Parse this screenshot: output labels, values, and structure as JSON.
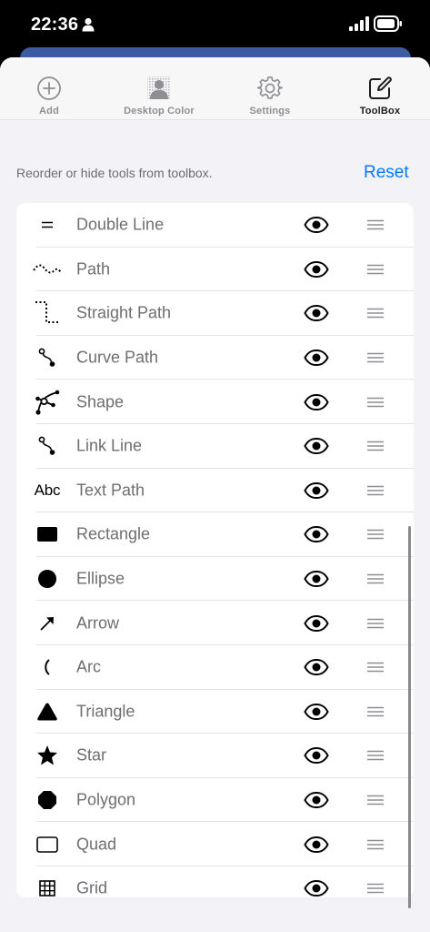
{
  "status_bar": {
    "time": "22:36"
  },
  "tabs": [
    {
      "label": "Add",
      "icon": "plus-circle-icon"
    },
    {
      "label": "Desktop Color",
      "icon": "desktop-color-icon"
    },
    {
      "label": "Settings",
      "icon": "gear-icon"
    },
    {
      "label": "ToolBox",
      "icon": "toolbox-edit-icon",
      "active": true
    }
  ],
  "hint": "Reorder or hide tools from toolbox.",
  "reset_label": "Reset",
  "icon_text_abc": "Abc",
  "tools": [
    {
      "label": "Double Line",
      "icon": "double-line-icon"
    },
    {
      "label": "Path",
      "icon": "path-icon"
    },
    {
      "label": "Straight Path",
      "icon": "straight-path-icon"
    },
    {
      "label": "Curve Path",
      "icon": "curve-path-icon"
    },
    {
      "label": "Shape",
      "icon": "shape-icon"
    },
    {
      "label": "Link Line",
      "icon": "link-line-icon"
    },
    {
      "label": "Text Path",
      "icon": "text-path-icon"
    },
    {
      "label": "Rectangle",
      "icon": "rectangle-icon"
    },
    {
      "label": "Ellipse",
      "icon": "ellipse-icon"
    },
    {
      "label": "Arrow",
      "icon": "arrow-icon"
    },
    {
      "label": "Arc",
      "icon": "arc-icon"
    },
    {
      "label": "Triangle",
      "icon": "triangle-icon"
    },
    {
      "label": "Star",
      "icon": "star-icon"
    },
    {
      "label": "Polygon",
      "icon": "polygon-icon"
    },
    {
      "label": "Quad",
      "icon": "quad-icon"
    },
    {
      "label": "Grid",
      "icon": "grid-icon"
    }
  ],
  "colors": {
    "accent": "#007aff",
    "background": "#f2f2f7",
    "behind_card": "#3c5ba3"
  }
}
